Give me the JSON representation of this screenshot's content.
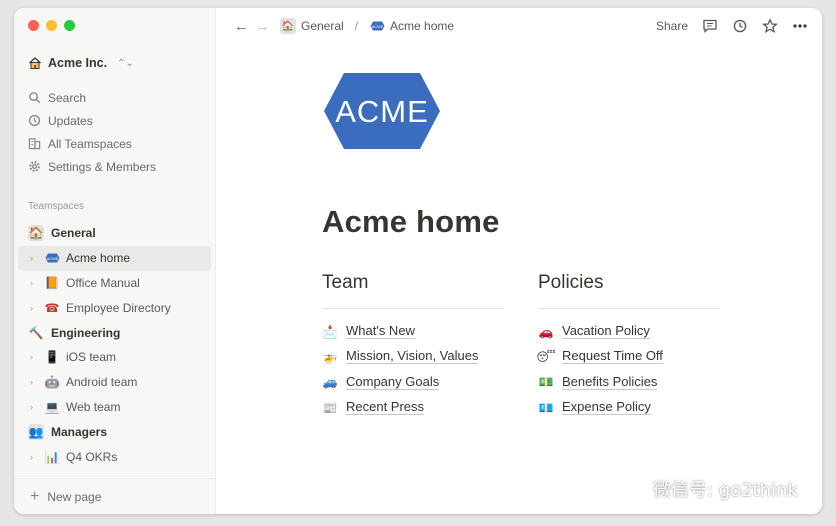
{
  "window": {
    "traffic_colors": [
      "#fe5f57",
      "#febc2e",
      "#28c840"
    ]
  },
  "sidebar": {
    "workspace": {
      "name": "Acme Inc.",
      "icon": "house-icon"
    },
    "nav": [
      {
        "label": "Search",
        "icon": "search-icon"
      },
      {
        "label": "Updates",
        "icon": "clock-icon"
      },
      {
        "label": "All Teamspaces",
        "icon": "buildings-icon"
      },
      {
        "label": "Settings & Members",
        "icon": "gear-icon"
      }
    ],
    "section_label": "Teamspaces",
    "tree": [
      {
        "kind": "team",
        "label": "General",
        "emoji": "🏠"
      },
      {
        "kind": "page",
        "label": "Acme home",
        "emoji": "ACME",
        "active": true
      },
      {
        "kind": "page",
        "label": "Office Manual",
        "emoji": "📙"
      },
      {
        "kind": "page",
        "label": "Employee Directory",
        "emoji": "☎"
      },
      {
        "kind": "team",
        "label": "Engineering",
        "emoji": "🔨"
      },
      {
        "kind": "page",
        "label": "iOS team",
        "emoji": "📱"
      },
      {
        "kind": "page",
        "label": "Android team",
        "emoji": "🤖"
      },
      {
        "kind": "page",
        "label": "Web team",
        "emoji": "💻"
      },
      {
        "kind": "team",
        "label": "Managers",
        "emoji": "👥"
      },
      {
        "kind": "page",
        "label": "Q4 OKRs",
        "emoji": "📊"
      }
    ],
    "new_page": "New page"
  },
  "topbar": {
    "breadcrumb": {
      "parent": "General",
      "separator": "/",
      "current": "Acme home"
    },
    "share": "Share"
  },
  "page": {
    "logo_text": "ACME",
    "brand_color": "#3b6dbf",
    "title": "Acme home",
    "columns": [
      {
        "heading": "Team",
        "links": [
          {
            "label": "What's New",
            "emoji": "📩"
          },
          {
            "label": "Mission, Vision, Values",
            "emoji": "🚁"
          },
          {
            "label": "Company Goals",
            "emoji": "🚙"
          },
          {
            "label": "Recent Press",
            "emoji": "📰"
          }
        ]
      },
      {
        "heading": "Policies",
        "links": [
          {
            "label": "Vacation Policy",
            "emoji": "🚗"
          },
          {
            "label": "Request Time Off",
            "emoji": "😴"
          },
          {
            "label": "Benefits Policies",
            "emoji": "💵"
          },
          {
            "label": "Expense Policy",
            "emoji": "💶"
          }
        ]
      }
    ]
  },
  "watermark": {
    "text": "微信号: go2think"
  }
}
